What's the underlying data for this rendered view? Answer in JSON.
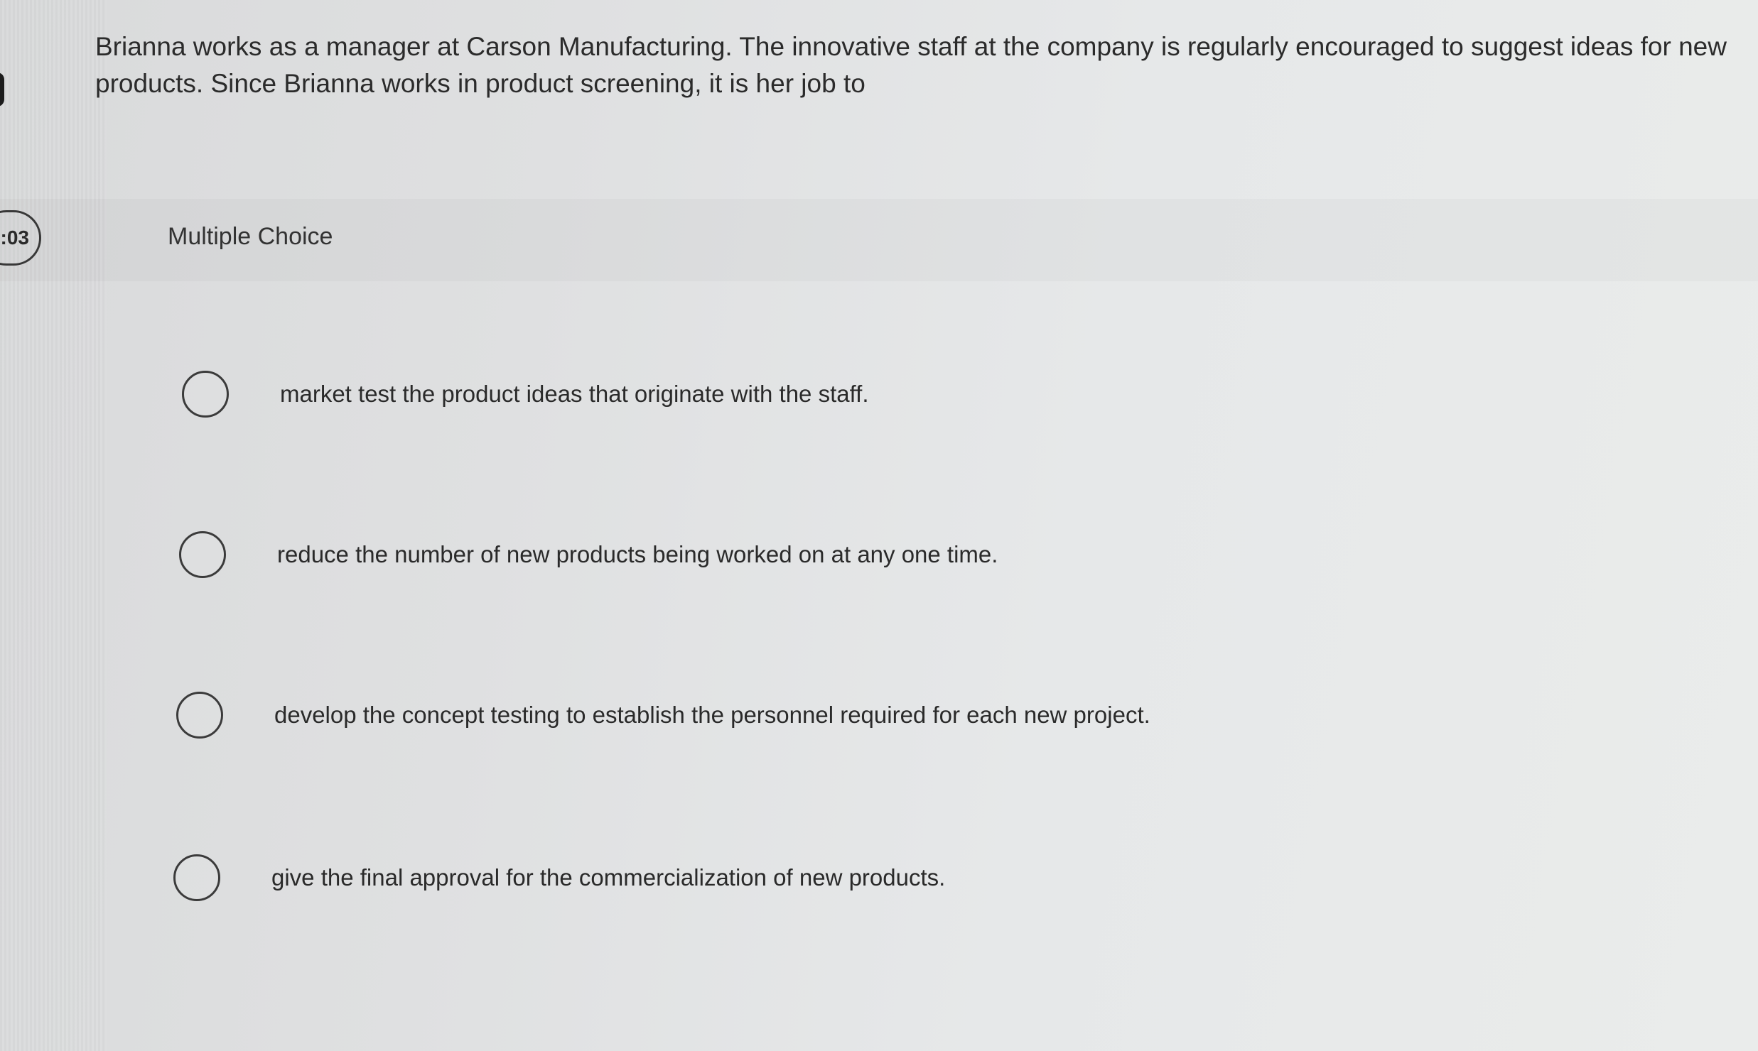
{
  "timer": {
    "text": ":03"
  },
  "question": {
    "text": "Brianna works as a manager at Carson Manufacturing. The innovative staff at the company is regularly encouraged to suggest ideas for new products. Since Brianna works in product screening, it is her job to"
  },
  "question_type": {
    "label": "Multiple Choice"
  },
  "options": [
    {
      "text": "market test the product ideas that originate with the staff.",
      "selected": false
    },
    {
      "text": "reduce the number of new products being worked on at any one time.",
      "selected": false
    },
    {
      "text": "develop the concept testing to establish the personnel required for each new project.",
      "selected": false
    },
    {
      "text": "give the final approval for the commercialization of new products.",
      "selected": false
    }
  ]
}
